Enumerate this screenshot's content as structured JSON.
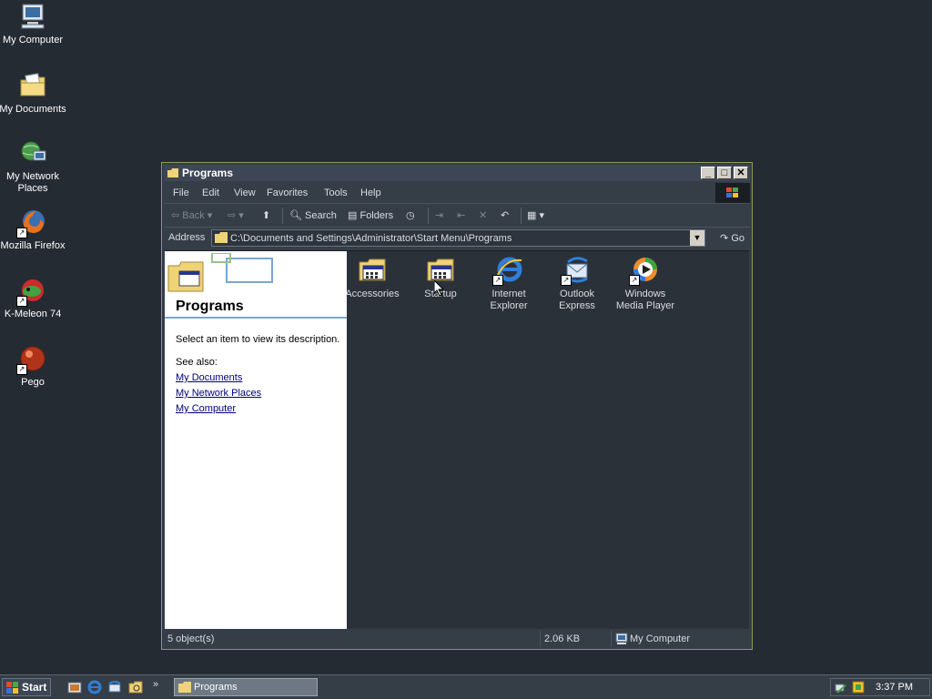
{
  "desktop": {
    "icons": [
      {
        "label": "My Computer",
        "icon": "computer-icon"
      },
      {
        "label": "My Documents",
        "icon": "documents-folder-icon"
      },
      {
        "label": "My Network Places",
        "icon": "network-places-icon"
      },
      {
        "label": "Mozilla Firefox",
        "icon": "firefox-icon"
      },
      {
        "label": "K-Meleon 74",
        "icon": "kmeleon-icon"
      },
      {
        "label": "Pego",
        "icon": "pego-icon"
      }
    ]
  },
  "window": {
    "title": "Programs",
    "menu": [
      "File",
      "Edit",
      "View",
      "Favorites",
      "Tools",
      "Help"
    ],
    "toolbar": {
      "back": "Back",
      "search": "Search",
      "folders": "Folders"
    },
    "address_label": "Address",
    "address_value": "C:\\Documents and Settings\\Administrator\\Start Menu\\Programs",
    "go_label": "Go",
    "left_pane": {
      "title": "Programs",
      "description": "Select an item to view its description.",
      "see_also": "See also:",
      "links": [
        "My Documents",
        "My Network Places",
        "My Computer"
      ]
    },
    "files": [
      {
        "label": "Accessories",
        "icon": "program-folder-icon"
      },
      {
        "label": "Startup",
        "icon": "program-folder-icon"
      },
      {
        "label": "Internet Explorer",
        "icon": "internet-explorer-icon"
      },
      {
        "label": "Outlook Express",
        "icon": "outlook-express-icon"
      },
      {
        "label": "Windows Media Player",
        "icon": "media-player-icon"
      }
    ],
    "status": {
      "objects": "5 object(s)",
      "size": "2.06 KB",
      "zone": "My Computer"
    }
  },
  "taskbar": {
    "start_label": "Start",
    "task_label": "Programs",
    "clock": "3:37 PM"
  }
}
